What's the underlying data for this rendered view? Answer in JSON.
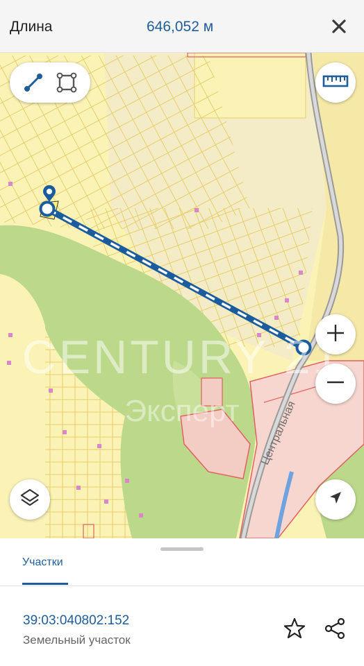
{
  "measure": {
    "label": "Длина",
    "value": "646,052 м"
  },
  "icons": {
    "close": "close-icon",
    "line_tool": "line-measure-icon",
    "area_tool": "area-measure-icon",
    "ruler": "ruler-icon",
    "zoom_in": "plus-icon",
    "zoom_out": "minus-icon",
    "layers": "layers-icon",
    "locate": "navigation-arrow-icon",
    "favorite": "star-icon",
    "share": "share-icon"
  },
  "map": {
    "street_label": "Центральная",
    "watermark_line1": "CENTURY 21",
    "watermark_line2": "Эксперт"
  },
  "sheet": {
    "tab_label": "Участки",
    "parcel_number": "39:03:040802:152",
    "parcel_type": "Земельный участок"
  },
  "colors": {
    "accent": "#1f5d9a",
    "measure_line": "#1a5c9e",
    "map_background": "#fbf2b6",
    "forest": "#bcd98b",
    "parcel_border": "#e6cf6b",
    "restricted_zone": "#e06060"
  }
}
